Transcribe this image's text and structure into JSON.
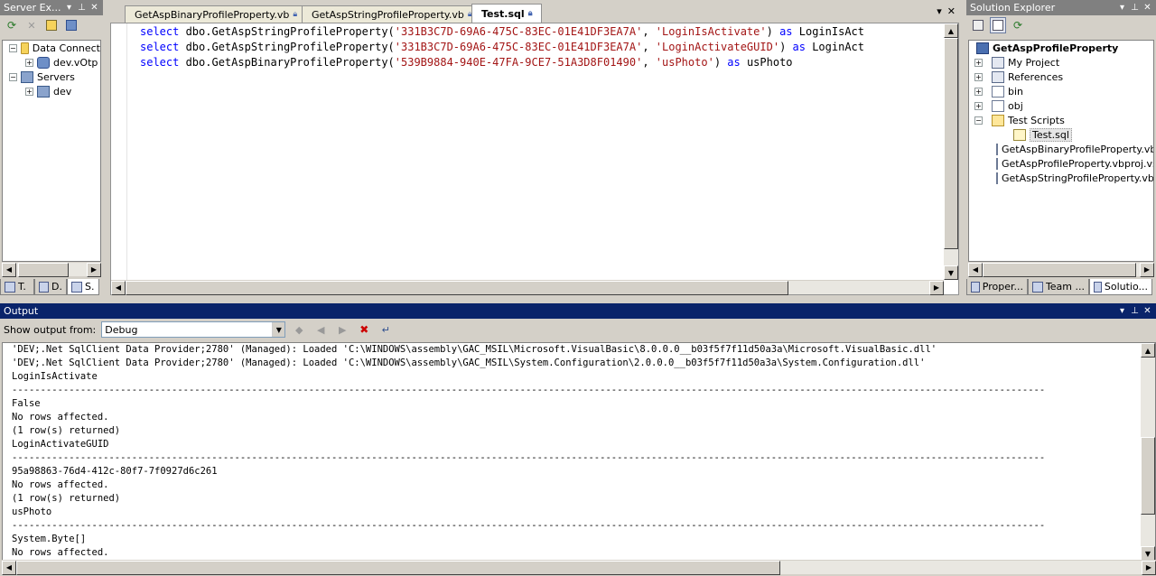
{
  "server_explorer": {
    "title": "Server Ex...",
    "tree": [
      {
        "label": "Data Connect",
        "icon": "data-connections-icon",
        "expanded": true
      },
      {
        "label": "dev.vOtp",
        "icon": "database-icon",
        "expanded": false
      },
      {
        "label": "Servers",
        "icon": "servers-icon",
        "expanded": true
      },
      {
        "label": "dev",
        "icon": "server-icon",
        "expanded": false
      }
    ],
    "bottom_tabs": [
      "T.",
      "D.",
      "S."
    ]
  },
  "document_tabs": [
    {
      "label": "GetAspBinaryProfileProperty.vb"
    },
    {
      "label": "GetAspStringProfileProperty.vb"
    },
    {
      "label": "Test.sql"
    }
  ],
  "editor": {
    "lines": [
      {
        "kw": "select",
        "fn": " dbo.GetAspStringProfileProperty(",
        "s1": "'331B3C7D-69A6-475C-83EC-01E41DF3EA7A'",
        "sep": ", ",
        "s2": "'LoginIsActivate'",
        "close": ") ",
        "as": "as",
        "alias": " LoginIsAct"
      },
      {
        "kw": "select",
        "fn": " dbo.GetAspStringProfileProperty(",
        "s1": "'331B3C7D-69A6-475C-83EC-01E41DF3EA7A'",
        "sep": ", ",
        "s2": "'LoginActivateGUID'",
        "close": ") ",
        "as": "as",
        "alias": " LoginAct"
      },
      {
        "kw": "select",
        "fn": " dbo.GetAspBinaryProfileProperty(",
        "s1": "'539B9884-940E-47FA-9CE7-51A3D8F01490'",
        "sep": ", ",
        "s2": "'usPhoto'",
        "close": ") ",
        "as": "as",
        "alias": " usPhoto"
      }
    ]
  },
  "solution_explorer": {
    "title": "Solution Explorer",
    "project": "GetAspProfileProperty",
    "tree": [
      {
        "label": "My Project",
        "icon": "my-project-icon"
      },
      {
        "label": "References",
        "icon": "references-icon"
      },
      {
        "label": "bin",
        "icon": "folder-icon"
      },
      {
        "label": "obj",
        "icon": "folder-icon"
      },
      {
        "label": "Test Scripts",
        "icon": "open-folder-icon"
      },
      {
        "label": "Test.sql",
        "icon": "sql-file-icon"
      },
      {
        "label": "GetAspBinaryProfileProperty.vb",
        "icon": "vb-file-icon"
      },
      {
        "label": "GetAspProfileProperty.vbproj.vsp",
        "icon": "file-icon"
      },
      {
        "label": "GetAspStringProfileProperty.vb",
        "icon": "vb-file-icon"
      }
    ],
    "bottom_tabs": [
      "Proper...",
      "Team ...",
      "Solutio..."
    ]
  },
  "output": {
    "title": "Output",
    "show_output_label": "Show output from:",
    "source": "Debug",
    "lines": [
      "'DEV;.Net SqlClient Data Provider;2780' (Managed): Loaded 'C:\\WINDOWS\\assembly\\GAC_MSIL\\Microsoft.VisualBasic\\8.0.0.0__b03f5f7f11d50a3a\\Microsoft.VisualBasic.dll'",
      "'DEV;.Net SqlClient Data Provider;2780' (Managed): Loaded 'C:\\WINDOWS\\assembly\\GAC_MSIL\\System.Configuration\\2.0.0.0__b03f5f7f11d50a3a\\System.Configuration.dll'",
      "LoginIsActivate",
      "-------------------------------------------------------------------------------------------------------------------------------------------------------------------------------------",
      "False",
      "No rows affected.",
      "(1 row(s) returned)",
      "LoginActivateGUID",
      "-------------------------------------------------------------------------------------------------------------------------------------------------------------------------------------",
      "95a98863-76d4-412c-80f7-7f0927d6c261",
      "No rows affected.",
      "(1 row(s) returned)",
      "usPhoto",
      "-------------------------------------------------------------------------------------------------------------------------------------------------------------------------------------",
      "System.Byte[]",
      "No rows affected."
    ]
  }
}
